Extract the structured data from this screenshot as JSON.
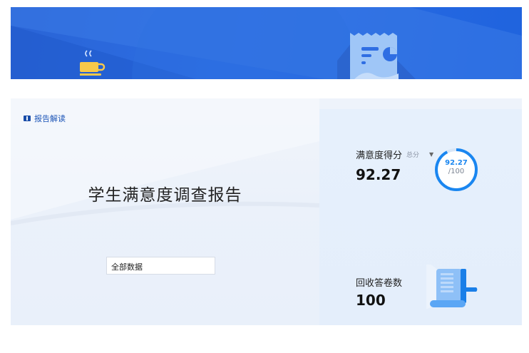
{
  "banner": {
    "cup_icon": "coffee-cup-icon",
    "receipt_icon": "receipt-chart-icon"
  },
  "report": {
    "tag_label": "报告解读",
    "tag_icon": "book-icon",
    "title": "学生满意度调查报告",
    "filter_value": "全部数据"
  },
  "score": {
    "label": "满意度得分",
    "sub_label": "总分",
    "value": "92.27",
    "gauge_value": "92.27",
    "gauge_total": "/100",
    "gauge_fraction": 0.9227,
    "accent": "#1a86f0"
  },
  "responses": {
    "label": "回收答卷数",
    "value": "100",
    "icon": "document-scroll-icon"
  }
}
